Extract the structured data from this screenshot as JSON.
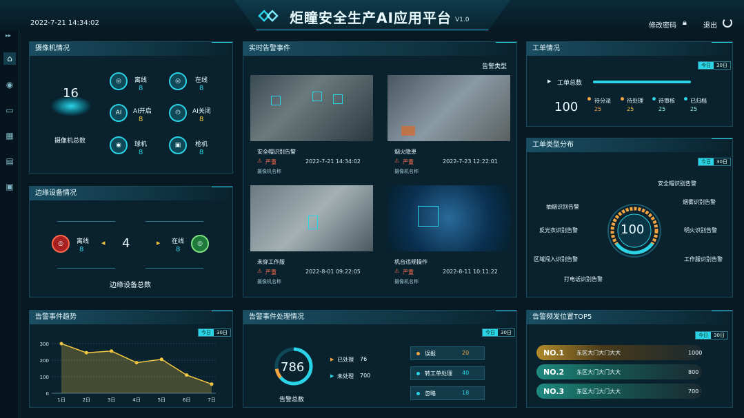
{
  "header": {
    "datetime": "2022-7-21 14:34:02",
    "title": "炬瞳安全生产AI应用平台",
    "version": "V1.0",
    "change_password": "修改密码",
    "logout": "退出"
  },
  "camera": {
    "title": "摄像机情况",
    "total": "16",
    "total_label": "摄像机总数",
    "stats": [
      {
        "label": "离线",
        "value": "8"
      },
      {
        "label": "在线",
        "value": "8"
      },
      {
        "label": "AI开启",
        "value": "8"
      },
      {
        "label": "AI关闭",
        "value": "8"
      },
      {
        "label": "球机",
        "value": "8"
      },
      {
        "label": "枪机",
        "value": "8"
      }
    ]
  },
  "edge": {
    "title": "边缘设备情况",
    "offline_label": "离线",
    "offline_value": "8",
    "online_label": "在线",
    "online_value": "8",
    "total": "4",
    "total_label": "边缘设备总数"
  },
  "alerts": {
    "title": "实时告警事件",
    "type_label": "告警类型",
    "cards": [
      {
        "name": "安全帽识别告警",
        "level": "严重",
        "time": "2022-7-21 14:34:02",
        "camera": "摄像机名称"
      },
      {
        "name": "烟火隐患",
        "level": "严重",
        "time": "2022-7-23 12:22:01",
        "camera": "摄像机名称"
      },
      {
        "name": "未穿工作服",
        "level": "严重",
        "time": "2022-8-01 09:22:05",
        "camera": "摄像机名称"
      },
      {
        "name": "机台违规操作",
        "level": "严重",
        "time": "2022-8-11 10:11:22",
        "camera": "摄像机名称"
      }
    ]
  },
  "workorder": {
    "title": "工单情况",
    "today": "今日",
    "days30": "30日",
    "total_label": "工单总数",
    "total": "100",
    "stats": [
      {
        "label": "待分派",
        "value": "25"
      },
      {
        "label": "待处理",
        "value": "25"
      },
      {
        "label": "待审核",
        "value": "25"
      },
      {
        "label": "已归档",
        "value": "25"
      }
    ]
  },
  "wotype": {
    "title": "工单类型分布",
    "today": "今日",
    "days30": "30日",
    "center": "100",
    "labels": [
      "安全帽识别告警",
      "烟雾识别告警",
      "明火识别告警",
      "工作服识别告警",
      "打电话识别告警",
      "区域闯入识别告警",
      "反光衣识别告警",
      "抽烟识别告警"
    ]
  },
  "trend": {
    "title": "告警事件趋势",
    "today": "今日",
    "days30": "30日"
  },
  "chart_data": {
    "type": "area",
    "categories": [
      "1日",
      "2日",
      "3日",
      "4日",
      "5日",
      "6日",
      "7日"
    ],
    "values": [
      300,
      245,
      255,
      185,
      205,
      110,
      55
    ],
    "ylim": [
      0,
      300
    ],
    "yticks": [
      0,
      100,
      200,
      300
    ]
  },
  "handling": {
    "title": "告警事件处理情况",
    "total": "786",
    "total_label": "告警总数",
    "done_label": "已处理",
    "done_value": "76",
    "undone_label": "未处理",
    "undone_value": "700",
    "rows": [
      {
        "label": "误报",
        "value": "20"
      },
      {
        "label": "转工单处理",
        "value": "40"
      },
      {
        "label": "忽略",
        "value": "18"
      }
    ]
  },
  "top5": {
    "title": "告警频发位置TOP5",
    "today": "今日",
    "days30": "30日",
    "rows": [
      {
        "rank": "NO.1",
        "place": "东区大门大门大大",
        "value": "1000"
      },
      {
        "rank": "NO.2",
        "place": "东区大门大门大大",
        "value": "800"
      },
      {
        "rank": "NO.3",
        "place": "东区大门大门大大",
        "value": "700"
      }
    ]
  },
  "colors": {
    "accent": "#2ad3e6",
    "warn": "#ff6b4a",
    "gold": "#f5c842"
  }
}
